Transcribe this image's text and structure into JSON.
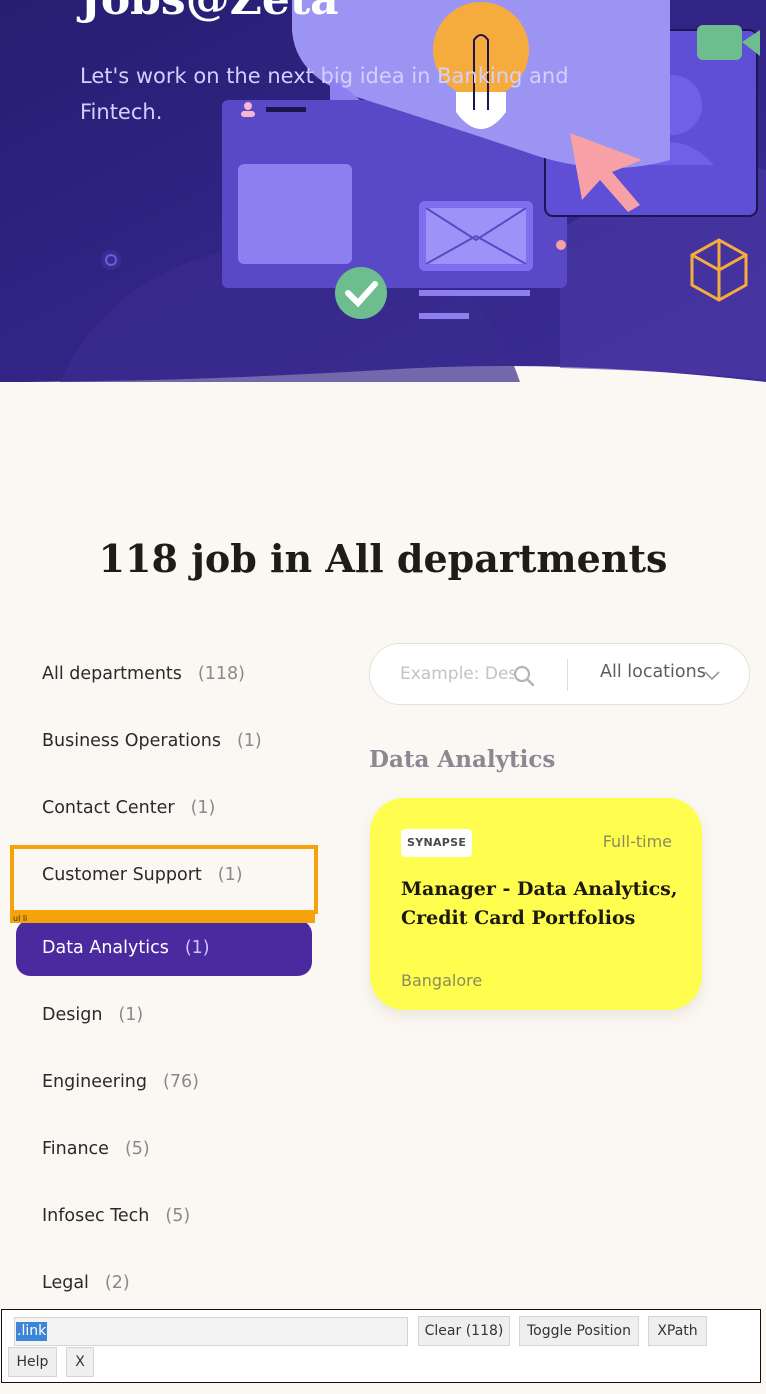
{
  "hero": {
    "title": "Jobs@Zeta",
    "subtitle": "Let's work on the next big idea in Banking and Fintech."
  },
  "main": {
    "heading": "118 job in All departments"
  },
  "departments": [
    {
      "name": "All departments",
      "count": "(118)"
    },
    {
      "name": "Business Operations",
      "count": "(1)"
    },
    {
      "name": "Contact Center",
      "count": "(1)"
    },
    {
      "name": "Customer Support",
      "count": "(1)"
    },
    {
      "name": "Data Analytics",
      "count": "(1)",
      "active": true
    },
    {
      "name": "Design",
      "count": "(1)"
    },
    {
      "name": "Engineering",
      "count": "(76)"
    },
    {
      "name": "Finance",
      "count": "(5)"
    },
    {
      "name": "Infosec Tech",
      "count": "(5)"
    },
    {
      "name": "Legal",
      "count": "(2)"
    }
  ],
  "highlight": {
    "label": "ul li"
  },
  "search": {
    "placeholder": "Example: Design",
    "location": "All locations"
  },
  "section_title": "Data Analytics",
  "job": {
    "badge": "SYNAPSE",
    "type": "Full-time",
    "title": "Manager - Data Analytics, Credit Card Portfolios",
    "location": "Bangalore"
  },
  "toolbar": {
    "input_value": ".link",
    "clear_label": "Clear (118)",
    "toggle_label": "Toggle Position",
    "xpath_label": "XPath",
    "help_label": "Help",
    "close_label": "X"
  },
  "colors": {
    "hero_bg": "#2e2484",
    "active_dept": "#4b2aa0",
    "job_card": "#fffd4d",
    "highlight": "#f5a30b"
  }
}
